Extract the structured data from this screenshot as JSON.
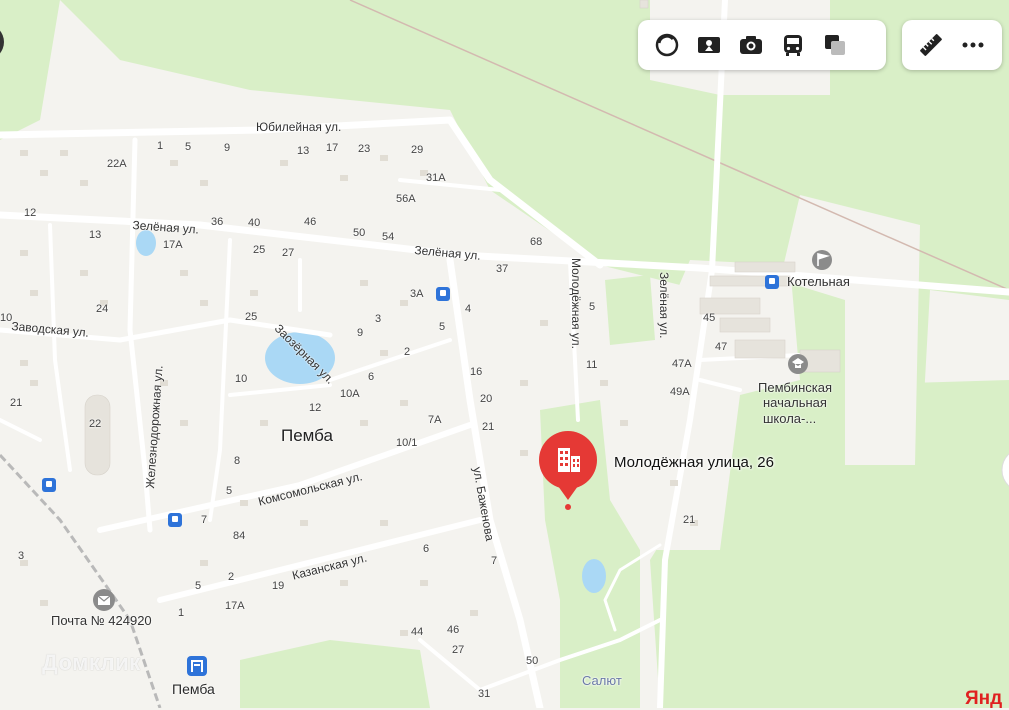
{
  "toolbar": {
    "layers": [
      "layers-icon",
      "panorama-icon",
      "photo-icon",
      "transit-icon",
      "traffic-icon"
    ],
    "tools": [
      "ruler-icon",
      "more-icon"
    ]
  },
  "colors": {
    "forest": "#d9efc7",
    "land": "#f4f3ef",
    "road": "#ffffff",
    "water": "#aad8f5",
    "pin": "#e53935"
  },
  "selected_place": {
    "label": "Молодёжная улица, 26"
  },
  "town": {
    "name": "Пемба"
  },
  "streets": {
    "yubileynaya": "Юбилейная ул.",
    "zelenaya_1": "Зелёная ул.",
    "zelenaya_2": "Зелёная ул.",
    "zelenaya_3": "Зелёная ул.",
    "zavodskaya": "Заводская ул.",
    "zaozernaya": "Заозёрная ул.",
    "zheleznodorozhnaya": "Железнодорожная ул.",
    "komsomolskaya": "Комсомольская ул.",
    "kazanskaya": "Казанская ул.",
    "bazhenova": "ул. Баженова",
    "molodezhnaya": "Молодёжная ул."
  },
  "pois": {
    "kotelnaya": "Котельная",
    "school_line1": "Пембинская",
    "school_line2": "начальная",
    "school_line3": "школа-...",
    "post": "Почта № 424920",
    "station": "Пемба",
    "salut": "Салют"
  },
  "house_numbers": [
    "1",
    "5",
    "9",
    "13",
    "17",
    "23",
    "29",
    "22А",
    "31А",
    "56А",
    "12",
    "36",
    "40",
    "46",
    "50",
    "54",
    "13",
    "17А",
    "25",
    "27",
    "68",
    "37",
    "3А",
    "4",
    "5",
    "25",
    "3",
    "9",
    "24",
    "10",
    "5",
    "2",
    "11",
    "45",
    "47",
    "47А",
    "49А",
    "6",
    "10А",
    "10",
    "12",
    "16",
    "20",
    "21",
    "21",
    "7А",
    "22",
    "10/1",
    "8",
    "5",
    "7",
    "84",
    "21",
    "6",
    "2",
    "5",
    "19",
    "7",
    "3",
    "1",
    "17А",
    "44",
    "46",
    "27",
    "50",
    "31"
  ],
  "watermark": "Домклик",
  "brand": "Янд"
}
